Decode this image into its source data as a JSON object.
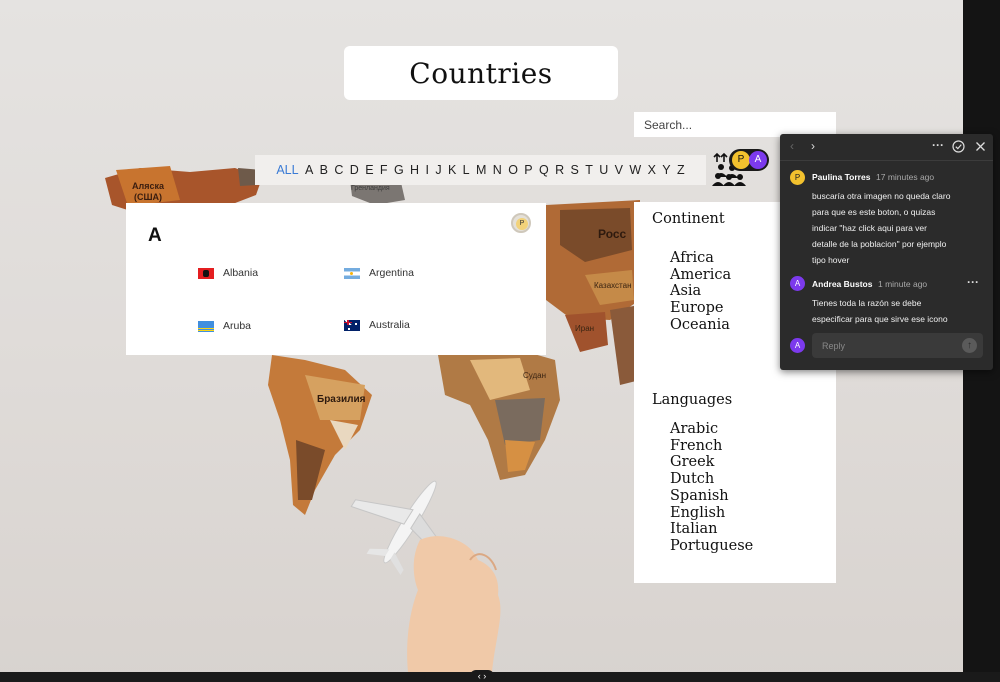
{
  "page": {
    "title": "Countries"
  },
  "search": {
    "placeholder": "Search..."
  },
  "alphabet": [
    "ALL",
    "A",
    "B",
    "C",
    "D",
    "E",
    "F",
    "G",
    "H",
    "I",
    "J",
    "K",
    "L",
    "M",
    "N",
    "O",
    "P",
    "Q",
    "R",
    "S",
    "T",
    "U",
    "V",
    "W",
    "X",
    "Y",
    "Z"
  ],
  "alphabet_active": "ALL",
  "map_labels": {
    "alaska": "Аляска",
    "alaska_sub": "(США)",
    "greenland": "Гренландия",
    "russia": "Росс",
    "kazakhstan": "Казахстан",
    "iran": "Иран",
    "sudan": "Судан",
    "brazil": "Бразилия"
  },
  "panel": {
    "letter": "A",
    "countries": [
      {
        "name": "Albania",
        "flag": "albania-flag-icon"
      },
      {
        "name": "Argentina",
        "flag": "argentina-flag-icon"
      },
      {
        "name": "Aruba",
        "flag": "aruba-flag-icon"
      },
      {
        "name": "Australia",
        "flag": "australia-flag-icon"
      }
    ],
    "pin_avatar": "P"
  },
  "filters": {
    "continent_title": "Continent",
    "continents": [
      "Africa",
      "America",
      "Asia",
      "Europe",
      "Oceania"
    ],
    "languages_title": "Languages",
    "languages": [
      "Arabic",
      "French",
      "Greek",
      "Dutch",
      "Spanish",
      "English",
      "Italian",
      "Portuguese"
    ]
  },
  "avatars": {
    "p": "P",
    "a": "A"
  },
  "comments_popup": {
    "comments": [
      {
        "avatar": "P",
        "author": "Paulina Torres",
        "time": "17 minutes ago",
        "lines": [
          "buscaría otra imagen no queda claro",
          "para que es este boton, o quizas",
          "indicar \"haz click aqui para ver",
          "detalle de la poblacion\" por ejemplo",
          "tipo hover"
        ]
      },
      {
        "avatar": "A",
        "author": "Andrea Bustos",
        "time": "1 minute ago",
        "lines": [
          "Tienes toda la razón se debe",
          "especificar para que sirve ese icono"
        ]
      }
    ],
    "reply_avatar": "A",
    "reply_placeholder": "Reply"
  },
  "colors": {
    "accent": "#3a7bd5",
    "avatar_p": "#f2c12e",
    "avatar_a": "#7c3aed",
    "popup_bg": "#2b2b2b"
  }
}
